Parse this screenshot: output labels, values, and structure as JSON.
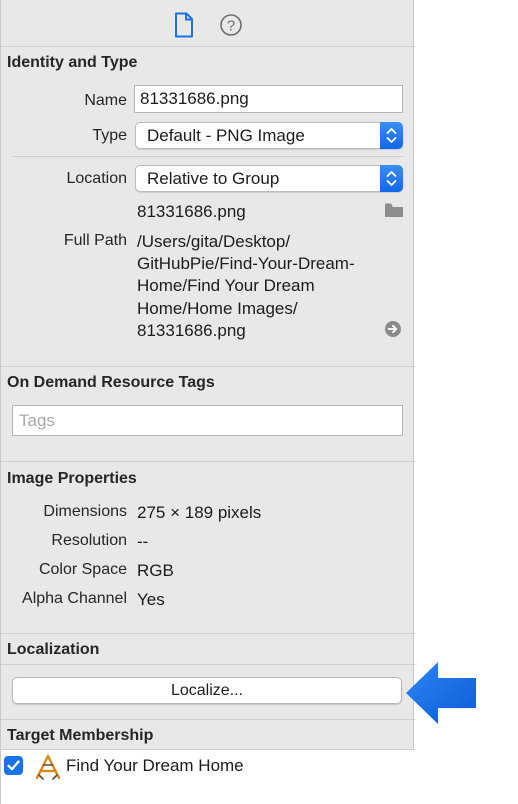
{
  "inspector_tabs": [
    {
      "icon": "file-inspector-icon"
    },
    {
      "icon": "quick-help-icon"
    }
  ],
  "identity": {
    "title": "Identity and Type",
    "name_label": "Name",
    "name_value": "81331686.png",
    "type_label": "Type",
    "type_value": "Default - PNG Image",
    "location_label": "Location",
    "location_value": "Relative to Group",
    "file_name": "81331686.png",
    "full_path_label": "Full Path",
    "full_path_lines": [
      "/Users/gita/Desktop/",
      "GitHubPie/Find-Your-Dream-",
      "Home/Find Your Dream",
      "Home/Home Images/",
      "81331686.png"
    ]
  },
  "on_demand": {
    "title": "On Demand Resource Tags",
    "tags_placeholder": "Tags"
  },
  "image_properties": {
    "title": "Image Properties",
    "rows": [
      {
        "label": "Dimensions",
        "value": "275 × 189 pixels"
      },
      {
        "label": "Resolution",
        "value": "--"
      },
      {
        "label": "Color Space",
        "value": "RGB"
      },
      {
        "label": "Alpha Channel",
        "value": "Yes"
      }
    ]
  },
  "localization": {
    "title": "Localization",
    "button_label": "Localize..."
  },
  "target_membership": {
    "title": "Target Membership",
    "target_name": "Find Your Dream Home",
    "checked": true
  },
  "colors": {
    "accent": "#1a73e8",
    "panel_bg": "#e8e8e8",
    "callout_arrow": "#1a6fe6"
  }
}
